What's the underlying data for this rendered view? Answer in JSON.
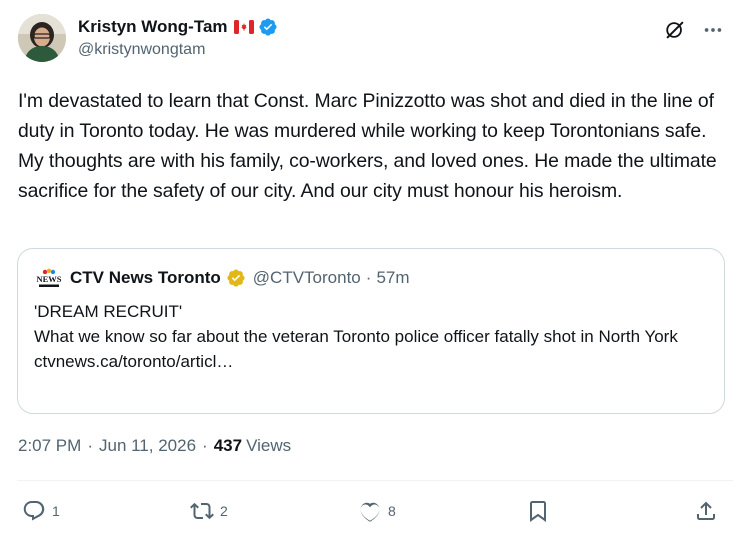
{
  "author": {
    "display_name": "Kristyn Wong-Tam",
    "handle": "@kristynwongtam",
    "flag": "canada-flag-icon",
    "badge": "verified-blue-icon"
  },
  "tweet": {
    "text": "I'm devastated to learn that Const. Marc Pinizzotto was shot and died in the line of duty in Toronto today. He was murdered while working to keep Torontonians safe. My thoughts are with his family, co-workers, and loved ones. He made the ultimate sacrifice for the safety of our city. And our city must honour his heroism."
  },
  "quote": {
    "display_name": "CTV News Toronto",
    "handle": "@CTVToronto",
    "separator": "·",
    "time": "57m",
    "badge": "verified-gold-icon",
    "line1": "'DREAM RECRUIT'",
    "line2": "What we know so far about the veteran Toronto police officer fatally shot in North York",
    "link": "ctvnews.ca/toronto/articl…"
  },
  "meta": {
    "time": "2:07 PM",
    "sep1": "·",
    "date": "Jun 11, 2026",
    "sep2": "·",
    "views_count": "437",
    "views_label": "Views"
  },
  "actions": {
    "reply_count": "1",
    "repost_count": "2",
    "like_count": "8"
  },
  "colors": {
    "text": "#0f1419",
    "secondary": "#536471",
    "verified_blue": "#1d9bf0",
    "verified_gold": "#e2b719",
    "border": "#cfd9de"
  }
}
